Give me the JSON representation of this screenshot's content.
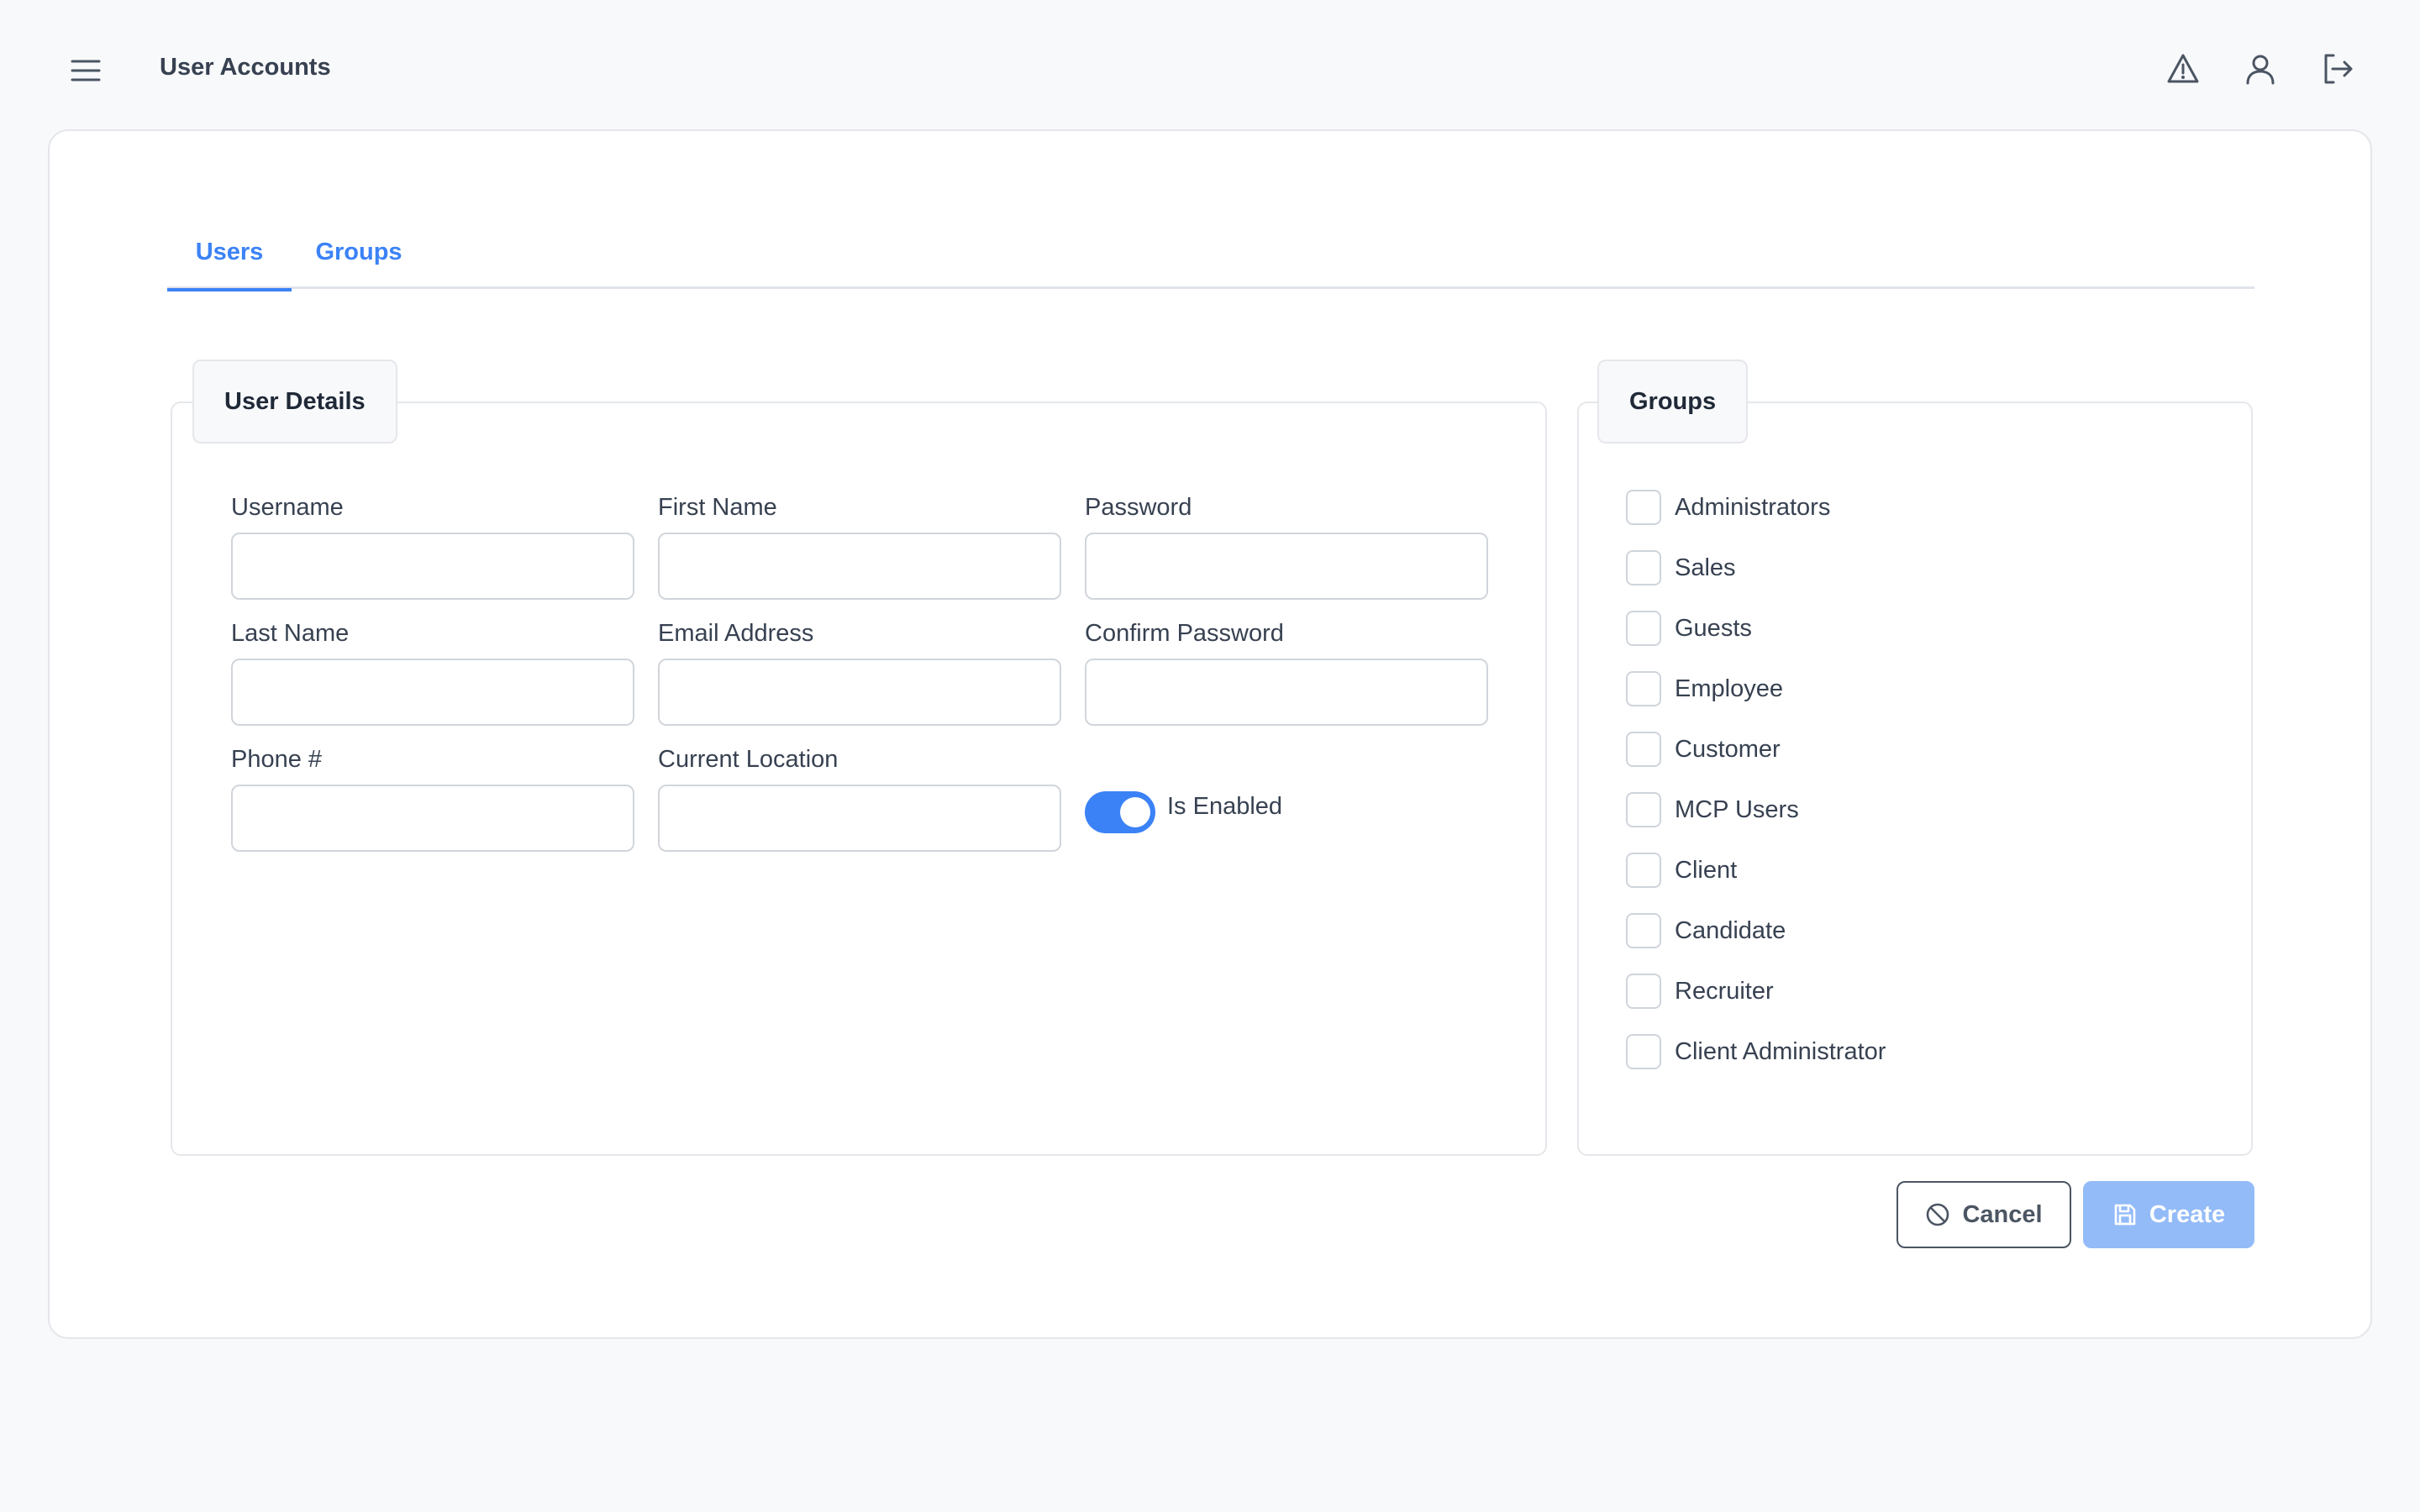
{
  "header": {
    "title": "User Accounts",
    "icons": [
      "menu-icon",
      "warning-icon",
      "user-icon",
      "logout-icon"
    ]
  },
  "tabs": [
    {
      "label": "Users",
      "active": true
    },
    {
      "label": "Groups",
      "active": false
    }
  ],
  "user_details": {
    "legend": "User Details",
    "fields": {
      "username": {
        "label": "Username",
        "value": ""
      },
      "first_name": {
        "label": "First Name",
        "value": ""
      },
      "password": {
        "label": "Password",
        "value": ""
      },
      "last_name": {
        "label": "Last Name",
        "value": ""
      },
      "email": {
        "label": "Email Address",
        "value": ""
      },
      "confirm_password": {
        "label": "Confirm Password",
        "value": ""
      },
      "phone": {
        "label": "Phone #",
        "value": ""
      },
      "location": {
        "label": "Current Location",
        "value": ""
      }
    },
    "enabled": {
      "label": "Is Enabled",
      "value": true
    }
  },
  "groups": {
    "legend": "Groups",
    "items": [
      {
        "label": "Administrators",
        "checked": false
      },
      {
        "label": "Sales",
        "checked": false
      },
      {
        "label": "Guests",
        "checked": false
      },
      {
        "label": "Employee",
        "checked": false
      },
      {
        "label": "Customer",
        "checked": false
      },
      {
        "label": "MCP Users",
        "checked": false
      },
      {
        "label": "Client",
        "checked": false
      },
      {
        "label": "Candidate",
        "checked": false
      },
      {
        "label": "Recruiter",
        "checked": false
      },
      {
        "label": "Client Administrator",
        "checked": false
      }
    ]
  },
  "actions": {
    "cancel_label": "Cancel",
    "create_label": "Create"
  },
  "colors": {
    "accent": "#3b82f6",
    "create_disabled": "#93bbf8",
    "background": "#f8f9fb"
  }
}
